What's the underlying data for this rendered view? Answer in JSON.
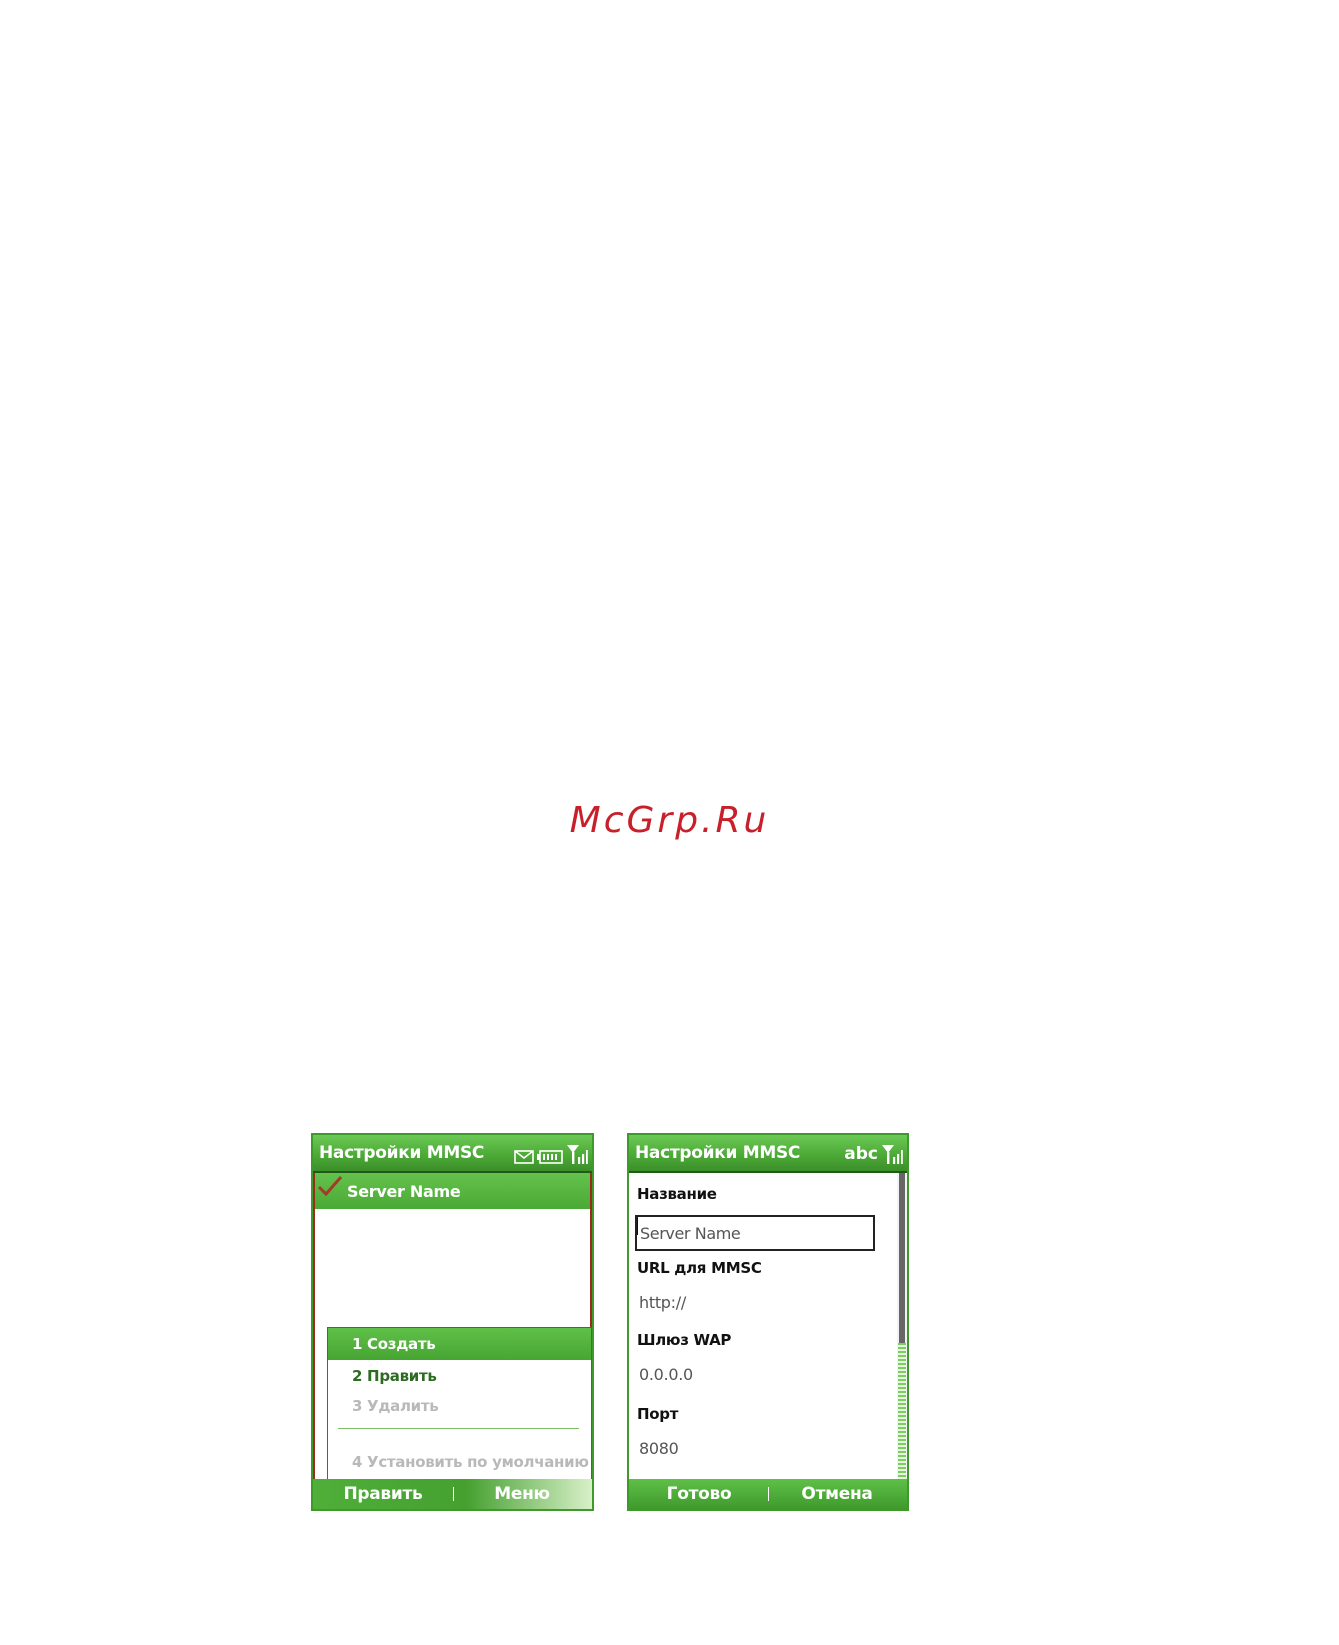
{
  "watermark": "McGrp.Ru",
  "left_screen": {
    "title": "Настройки MMSC",
    "status_icons": [
      "envelope-icon",
      "battery-icon",
      "signal-icon"
    ],
    "list": [
      {
        "label": "Server Name",
        "icon": "check-icon",
        "selected": true
      }
    ],
    "menu": {
      "items": [
        {
          "label": "1 Создать",
          "state": "active"
        },
        {
          "label": "2 Править",
          "state": "normal"
        },
        {
          "label": "3 Удалить",
          "state": "disabled"
        },
        {
          "label": "4 Установить по умолчанию",
          "state": "disabled"
        }
      ]
    },
    "softkeys": {
      "left": "Править",
      "right": "Меню"
    }
  },
  "right_screen": {
    "title": "Настройки MMSC",
    "input_mode": "abc",
    "status_icons": [
      "signal-icon"
    ],
    "fields": {
      "name": {
        "label": "Название",
        "value": "Server Name"
      },
      "url": {
        "label": "URL для MMSC",
        "value": "http://"
      },
      "wap": {
        "label": "Шлюз WAP",
        "value": "0.0.0.0"
      },
      "port": {
        "label": "Порт",
        "value": "8080"
      }
    },
    "softkeys": {
      "left": "Готово",
      "right": "Отмена"
    }
  },
  "colors": {
    "accent_green": "#4daa37",
    "watermark_red": "#c8202a"
  }
}
